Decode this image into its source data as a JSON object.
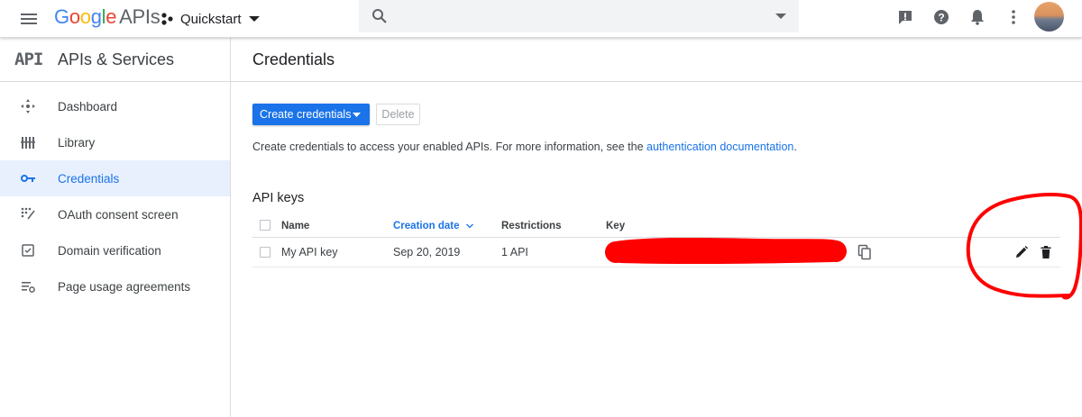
{
  "header": {
    "logo_google": "Google",
    "logo_apis": "APIs",
    "project_name": "Quickstart",
    "search_placeholder": "",
    "icons": [
      "menu-icon",
      "project-icon",
      "search-icon",
      "feedback-icon",
      "help-icon",
      "notifications-icon",
      "more-vert-icon"
    ]
  },
  "sidebar": {
    "logo_text": "API",
    "title": "APIs & Services",
    "items": [
      {
        "label": "Dashboard",
        "icon": "dashboard-icon",
        "active": false
      },
      {
        "label": "Library",
        "icon": "library-icon",
        "active": false
      },
      {
        "label": "Credentials",
        "icon": "key-icon",
        "active": true
      },
      {
        "label": "OAuth consent screen",
        "icon": "oauth-icon",
        "active": false
      },
      {
        "label": "Domain verification",
        "icon": "domain-verification-icon",
        "active": false
      },
      {
        "label": "Page usage agreements",
        "icon": "settings-list-icon",
        "active": false
      }
    ]
  },
  "main": {
    "title": "Credentials",
    "create_button": "Create credentials",
    "delete_button": "Delete",
    "info_text": "Create credentials to access your enabled APIs. For more information, see the ",
    "info_link": "authentication documentation",
    "info_end": ".",
    "section_title": "API keys",
    "table": {
      "headers": {
        "name": "Name",
        "creation_date": "Creation date",
        "restrictions": "Restrictions",
        "key": "Key"
      },
      "rows": [
        {
          "name": "My API key",
          "creation_date": "Sep 20, 2019",
          "restrictions": "1 API",
          "key": ""
        }
      ]
    }
  },
  "colors": {
    "accent": "#1a73e8",
    "active_bg": "#e8f0fe",
    "annotation": "#ff0000"
  }
}
